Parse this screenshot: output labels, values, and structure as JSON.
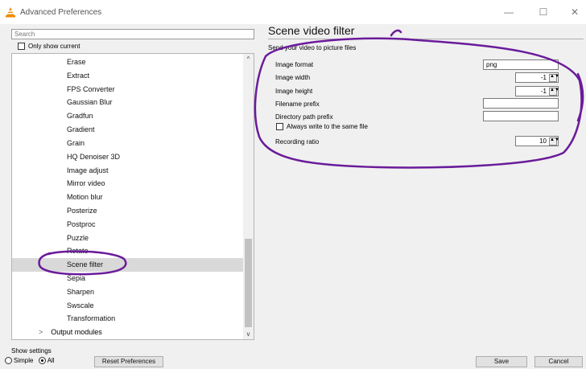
{
  "window": {
    "title": "Advanced Preferences",
    "icon": "vlc-cone-icon",
    "controls": {
      "minimize": "—",
      "maximize": "☐",
      "close": "✕"
    }
  },
  "search": {
    "placeholder": "Search"
  },
  "only_show_current": {
    "label": "Only show current",
    "checked": false
  },
  "tree": {
    "items": [
      {
        "label": "Erase",
        "selected": false
      },
      {
        "label": "Extract",
        "selected": false
      },
      {
        "label": "FPS Converter",
        "selected": false
      },
      {
        "label": "Gaussian Blur",
        "selected": false
      },
      {
        "label": "Gradfun",
        "selected": false
      },
      {
        "label": "Gradient",
        "selected": false
      },
      {
        "label": "Grain",
        "selected": false
      },
      {
        "label": "HQ Denoiser 3D",
        "selected": false
      },
      {
        "label": "Image adjust",
        "selected": false
      },
      {
        "label": "Mirror video",
        "selected": false
      },
      {
        "label": "Motion blur",
        "selected": false
      },
      {
        "label": "Posterize",
        "selected": false
      },
      {
        "label": "Postproc",
        "selected": false
      },
      {
        "label": "Puzzle",
        "selected": false
      },
      {
        "label": "Rotate",
        "selected": false
      },
      {
        "label": "Scene filter",
        "selected": true
      },
      {
        "label": "Sepia",
        "selected": false
      },
      {
        "label": "Sharpen",
        "selected": false
      },
      {
        "label": "Swscale",
        "selected": false
      },
      {
        "label": "Transformation",
        "selected": false
      }
    ],
    "parent": {
      "label": "Output modules",
      "chevron": ">"
    },
    "scroll_up": "^",
    "scroll_down": "v"
  },
  "panel": {
    "title": "Scene video filter",
    "description": "Send your video to picture files",
    "fields": {
      "image_format": {
        "label": "Image format",
        "value": "png"
      },
      "image_width": {
        "label": "Image width",
        "value": "-1"
      },
      "image_height": {
        "label": "Image height",
        "value": "-1"
      },
      "filename_prefix": {
        "label": "Filename prefix",
        "value": ""
      },
      "directory_path_prefix": {
        "label": "Directory path prefix",
        "value": ""
      },
      "always_write": {
        "label": "Always write to the same file",
        "checked": false
      },
      "recording_ratio": {
        "label": "Recording ratio",
        "value": "10"
      }
    },
    "spin_arrows": "▲▼"
  },
  "footer": {
    "show_settings": "Show settings",
    "simple": "Simple",
    "all": "All",
    "mode": "All",
    "reset": "Reset Preferences",
    "save": "Save",
    "cancel": "Cancel"
  },
  "annotation_color": "#6a1b9a"
}
